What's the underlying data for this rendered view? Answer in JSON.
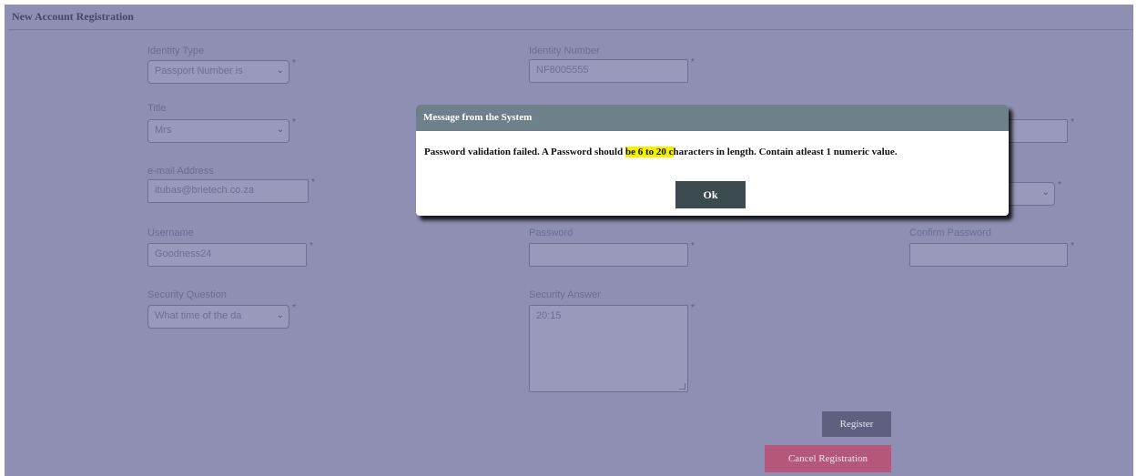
{
  "page": {
    "title": "New Account Registration"
  },
  "form": {
    "identity_type": {
      "label": "Identity Type",
      "value": "Passport Number is"
    },
    "identity_number": {
      "label": "Identity Number",
      "value": "NF8005555"
    },
    "title": {
      "label": "Title",
      "value": "Mrs"
    },
    "email": {
      "label": "e-mail Address",
      "value": "itubas@brietech.co.za"
    },
    "username": {
      "label": "Username",
      "value": "Goodness24"
    },
    "password": {
      "label": "Password",
      "value": ""
    },
    "confirm_password": {
      "label": "Confirm Password",
      "value": ""
    },
    "security_question": {
      "label": "Security Question",
      "value": "What time of the da"
    },
    "security_answer": {
      "label": "Security Answer",
      "value": "20:15"
    },
    "required_marker": "*"
  },
  "buttons": {
    "register": "Register",
    "cancel": "Cancel Registration"
  },
  "modal": {
    "title": "Message from the System",
    "message_before": "Password validation failed. A Password should ",
    "message_highlight_1": "be 6 to 20 c",
    "message_after": "haracters in length. Contain atleast 1 numeric value.",
    "ok_label": "Ok",
    "highlight_color": "#f2f200"
  },
  "icons": {
    "select_chevron": "chevron-down-icon"
  }
}
